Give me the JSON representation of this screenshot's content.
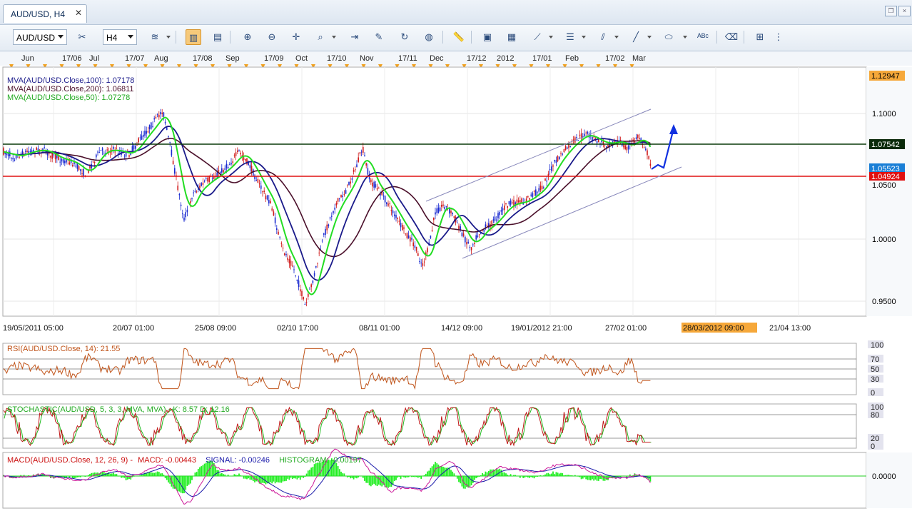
{
  "tab": {
    "title": "AUD/USD, H4",
    "close": "✕"
  },
  "toolbar": {
    "symbol": "AUD/USD",
    "timeframe": "H4"
  },
  "top_axis_labels": [
    "Jun",
    "17/06",
    "Jul",
    "17/07",
    "Aug",
    "17/08",
    "Sep",
    "17/09",
    "Oct",
    "17/10",
    "Nov",
    "17/11",
    "Dec",
    "17/12",
    "2012",
    "17/01",
    "Feb",
    "17/02",
    "Mar"
  ],
  "main_chart": {
    "legend": [
      "MVA(AUD/USD.Close,100): 1.07178",
      "MVA(AUD/USD.Close,200): 1.06811",
      "MVA(AUD/USD.Close,50): 1.07278"
    ],
    "price_ticks": [
      "1.1000",
      "1.0500",
      "1.0000",
      "0.9500"
    ],
    "price_flags": {
      "top": "1.12947",
      "green": "1.07542",
      "blue": "1.05523",
      "red": "1.04924"
    },
    "time_labels": [
      "19/05/2011 05:00",
      "20/07 01:00",
      "25/08 09:00",
      "02/10 17:00",
      "08/11 01:00",
      "14/12 09:00",
      "19/01/2012 21:00",
      "27/02 01:00",
      "28/03/2012 09:00",
      "21/04 13:00"
    ],
    "colors": {
      "ma100": "#1a1a8a",
      "ma200": "#4a0f2a",
      "ma50": "#22dd22",
      "resistance": "#0a3a0a",
      "support": "#e01010",
      "forecast": "#1030e0"
    }
  },
  "rsi": {
    "legend": "RSI(AUD/USD.Close, 14): 21.55",
    "ticks": [
      "100",
      "70",
      "50",
      "30",
      "0"
    ]
  },
  "stochastic": {
    "legend": "STOCHASTIC(AUD/USD, 5, 3, 3, MVA, MVA) - K: 8.57  D: 12.16",
    "ticks": [
      "100",
      "80",
      "20",
      "0"
    ]
  },
  "macd": {
    "legend_name": "MACD(AUD/USD.Close, 12, 26, 9) -",
    "legend_macd": "MACD: -0.00443",
    "legend_signal": "SIGNAL: -0.00246",
    "legend_hist": "HISTOGRAM: -0.00197",
    "ticks": [
      "0.0000"
    ]
  }
}
